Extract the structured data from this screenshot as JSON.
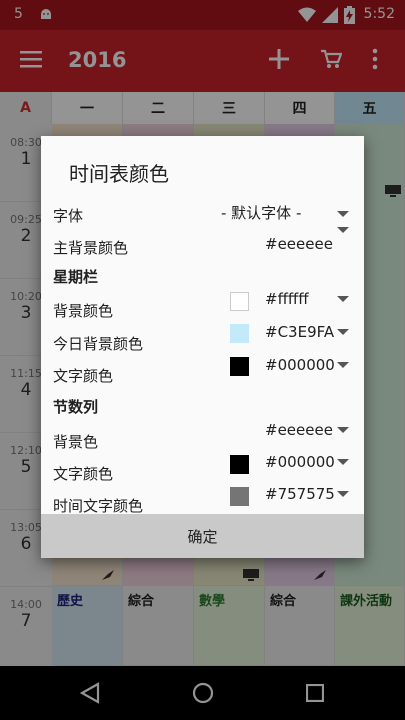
{
  "status": {
    "left_number": "5",
    "time": "5:52"
  },
  "appbar": {
    "title": "2016"
  },
  "grid": {
    "corner": "A",
    "days": [
      "一",
      "二",
      "三",
      "四",
      "五"
    ],
    "rows": [
      {
        "time": "08:30",
        "num": "1"
      },
      {
        "time": "09:25",
        "num": "2"
      },
      {
        "time": "10:20",
        "num": "3"
      },
      {
        "time": "11:15",
        "num": "4"
      },
      {
        "time": "12:10",
        "num": "5"
      },
      {
        "time": "13:05",
        "num": "6"
      },
      {
        "time": "14:00",
        "num": "7"
      }
    ],
    "bottom_cells": [
      "歷史",
      "綜合",
      "數學",
      "綜合",
      "課外活動"
    ]
  },
  "dialog": {
    "title": "时间表颜色",
    "font_label": "字体",
    "font_value": "- 默认字体 -",
    "main_bg_label": "主背景颜色",
    "main_bg_value": "#eeeeee",
    "weekbar_section": "星期栏",
    "week_bg_label": "背景颜色",
    "week_bg_value": "#ffffff",
    "week_today_label": "今日背景颜色",
    "week_today_value": "#C3E9FA",
    "week_text_label": "文字颜色",
    "week_text_value": "#000000",
    "period_section": "节数列",
    "period_bg_label": "背景色",
    "period_bg_value": "#eeeeee",
    "period_text_label": "文字颜色",
    "period_text_value": "#000000",
    "period_time_label": "时间文字颜色",
    "period_time_value": "#757575",
    "ok_label": "确定"
  },
  "colors": {
    "appbar": "#c8222a",
    "statusbar": "#a8161d",
    "accent": "#d32f2f"
  }
}
